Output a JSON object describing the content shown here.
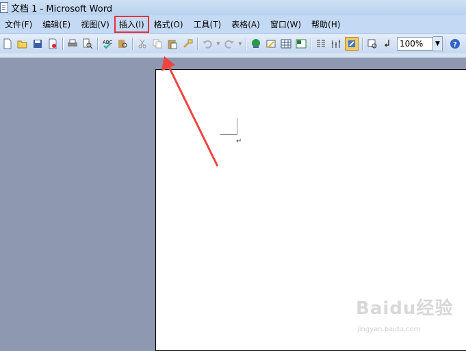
{
  "window": {
    "title": "文档 1 - Microsoft Word"
  },
  "menubar": {
    "items": [
      "文件(F)",
      "编辑(E)",
      "视图(V)",
      "插入(I)",
      "格式(O)",
      "工具(T)",
      "表格(A)",
      "窗口(W)",
      "帮助(H)"
    ],
    "highlighted": "插入(I)",
    "highlight_color": "#e8313b"
  },
  "toolbar": {
    "zoom_value": "100%",
    "icons": [
      "new-icon",
      "open-icon",
      "save-icon",
      "permission-icon",
      "print-icon",
      "print-preview-icon",
      "spelling-icon",
      "research-icon",
      "cut-icon",
      "copy-icon",
      "paste-icon",
      "format-painter-icon",
      "undo-icon",
      "redo-icon",
      "hyperlink-icon",
      "tables-borders-icon",
      "insert-table-icon",
      "insert-excel-icon",
      "columns-icon",
      "drawing-icon",
      "document-map-icon",
      "show-hide-icon",
      "read-icon",
      "help-icon"
    ]
  },
  "document": {
    "paragraph_mark": "↵"
  },
  "watermark": {
    "main": "Baidu经验",
    "sub": "jingyan.baidu.com"
  },
  "annotation": {
    "arrow_color": "#f0443e"
  }
}
